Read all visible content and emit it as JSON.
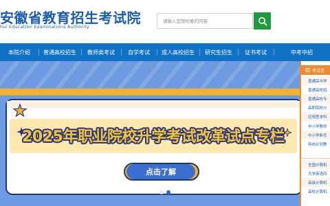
{
  "header": {
    "title": "安徽省教育招生考试院",
    "subtitle": "hui Education Examinations Authority",
    "search_placeholder": "请输入您想检索的内容"
  },
  "nav": {
    "items": [
      {
        "label": "本院介绍"
      },
      {
        "label": "普通高校招生"
      },
      {
        "label": "教师类考试"
      },
      {
        "label": "自学考试"
      },
      {
        "label": "成人高校招生"
      },
      {
        "label": "研究生招生"
      },
      {
        "label": "证书考试"
      },
      {
        "label": "中考中招"
      }
    ]
  },
  "banner": {
    "headline": "2025年职业院校升学考试改革试点专栏",
    "cta_label": "点击了解"
  },
  "side_panel": {
    "title": "考试咨",
    "items": [
      {
        "label": "普通高中学"
      },
      {
        "label": "普通高校招"
      },
      {
        "label": "普通高校专"
      },
      {
        "label": "高职院校分"
      },
      {
        "label": "应用型本科"
      },
      {
        "label": "中小学教师"
      },
      {
        "label": "中小学新任"
      },
      {
        "label": "特岗计划教"
      },
      {
        "label": "全国计算机"
      },
      {
        "label": "大学英语四"
      },
      {
        "label": "高级计算机"
      },
      {
        "label": "高校计算机"
      }
    ]
  },
  "colors": {
    "nav_blue": "#0f72c5",
    "search_green": "#1f9a3d",
    "side_orange": "#f08a2c",
    "banner_blue": "#6d9ae0",
    "banner_yellow": "#f3b12d",
    "title_blue": "#1a5db0"
  },
  "icons": {
    "search": "search-icon",
    "menu": "menu-icon",
    "stars": "star-icon"
  }
}
